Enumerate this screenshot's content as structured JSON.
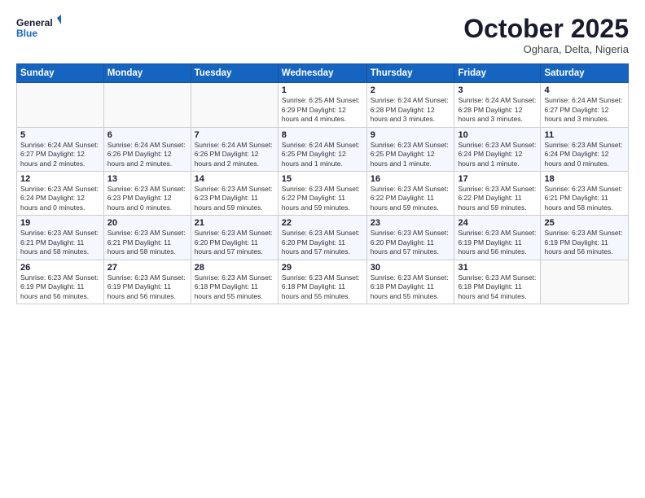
{
  "header": {
    "logo_line1": "General",
    "logo_line2": "Blue",
    "month": "October 2025",
    "location": "Oghara, Delta, Nigeria"
  },
  "days_of_week": [
    "Sunday",
    "Monday",
    "Tuesday",
    "Wednesday",
    "Thursday",
    "Friday",
    "Saturday"
  ],
  "weeks": [
    [
      {
        "day": "",
        "info": ""
      },
      {
        "day": "",
        "info": ""
      },
      {
        "day": "",
        "info": ""
      },
      {
        "day": "1",
        "info": "Sunrise: 6:25 AM\nSunset: 6:29 PM\nDaylight: 12 hours\nand 4 minutes."
      },
      {
        "day": "2",
        "info": "Sunrise: 6:24 AM\nSunset: 6:28 PM\nDaylight: 12 hours\nand 3 minutes."
      },
      {
        "day": "3",
        "info": "Sunrise: 6:24 AM\nSunset: 6:28 PM\nDaylight: 12 hours\nand 3 minutes."
      },
      {
        "day": "4",
        "info": "Sunrise: 6:24 AM\nSunset: 6:27 PM\nDaylight: 12 hours\nand 3 minutes."
      }
    ],
    [
      {
        "day": "5",
        "info": "Sunrise: 6:24 AM\nSunset: 6:27 PM\nDaylight: 12 hours\nand 2 minutes."
      },
      {
        "day": "6",
        "info": "Sunrise: 6:24 AM\nSunset: 6:26 PM\nDaylight: 12 hours\nand 2 minutes."
      },
      {
        "day": "7",
        "info": "Sunrise: 6:24 AM\nSunset: 6:26 PM\nDaylight: 12 hours\nand 2 minutes."
      },
      {
        "day": "8",
        "info": "Sunrise: 6:24 AM\nSunset: 6:25 PM\nDaylight: 12 hours\nand 1 minute."
      },
      {
        "day": "9",
        "info": "Sunrise: 6:23 AM\nSunset: 6:25 PM\nDaylight: 12 hours\nand 1 minute."
      },
      {
        "day": "10",
        "info": "Sunrise: 6:23 AM\nSunset: 6:24 PM\nDaylight: 12 hours\nand 1 minute."
      },
      {
        "day": "11",
        "info": "Sunrise: 6:23 AM\nSunset: 6:24 PM\nDaylight: 12 hours\nand 0 minutes."
      }
    ],
    [
      {
        "day": "12",
        "info": "Sunrise: 6:23 AM\nSunset: 6:24 PM\nDaylight: 12 hours\nand 0 minutes."
      },
      {
        "day": "13",
        "info": "Sunrise: 6:23 AM\nSunset: 6:23 PM\nDaylight: 12 hours\nand 0 minutes."
      },
      {
        "day": "14",
        "info": "Sunrise: 6:23 AM\nSunset: 6:23 PM\nDaylight: 11 hours\nand 59 minutes."
      },
      {
        "day": "15",
        "info": "Sunrise: 6:23 AM\nSunset: 6:22 PM\nDaylight: 11 hours\nand 59 minutes."
      },
      {
        "day": "16",
        "info": "Sunrise: 6:23 AM\nSunset: 6:22 PM\nDaylight: 11 hours\nand 59 minutes."
      },
      {
        "day": "17",
        "info": "Sunrise: 6:23 AM\nSunset: 6:22 PM\nDaylight: 11 hours\nand 59 minutes."
      },
      {
        "day": "18",
        "info": "Sunrise: 6:23 AM\nSunset: 6:21 PM\nDaylight: 11 hours\nand 58 minutes."
      }
    ],
    [
      {
        "day": "19",
        "info": "Sunrise: 6:23 AM\nSunset: 6:21 PM\nDaylight: 11 hours\nand 58 minutes."
      },
      {
        "day": "20",
        "info": "Sunrise: 6:23 AM\nSunset: 6:21 PM\nDaylight: 11 hours\nand 58 minutes."
      },
      {
        "day": "21",
        "info": "Sunrise: 6:23 AM\nSunset: 6:20 PM\nDaylight: 11 hours\nand 57 minutes."
      },
      {
        "day": "22",
        "info": "Sunrise: 6:23 AM\nSunset: 6:20 PM\nDaylight: 11 hours\nand 57 minutes."
      },
      {
        "day": "23",
        "info": "Sunrise: 6:23 AM\nSunset: 6:20 PM\nDaylight: 11 hours\nand 57 minutes."
      },
      {
        "day": "24",
        "info": "Sunrise: 6:23 AM\nSunset: 6:19 PM\nDaylight: 11 hours\nand 56 minutes."
      },
      {
        "day": "25",
        "info": "Sunrise: 6:23 AM\nSunset: 6:19 PM\nDaylight: 11 hours\nand 56 minutes."
      }
    ],
    [
      {
        "day": "26",
        "info": "Sunrise: 6:23 AM\nSunset: 6:19 PM\nDaylight: 11 hours\nand 56 minutes."
      },
      {
        "day": "27",
        "info": "Sunrise: 6:23 AM\nSunset: 6:19 PM\nDaylight: 11 hours\nand 56 minutes."
      },
      {
        "day": "28",
        "info": "Sunrise: 6:23 AM\nSunset: 6:18 PM\nDaylight: 11 hours\nand 55 minutes."
      },
      {
        "day": "29",
        "info": "Sunrise: 6:23 AM\nSunset: 6:18 PM\nDaylight: 11 hours\nand 55 minutes."
      },
      {
        "day": "30",
        "info": "Sunrise: 6:23 AM\nSunset: 6:18 PM\nDaylight: 11 hours\nand 55 minutes."
      },
      {
        "day": "31",
        "info": "Sunrise: 6:23 AM\nSunset: 6:18 PM\nDaylight: 11 hours\nand 54 minutes."
      },
      {
        "day": "",
        "info": ""
      }
    ]
  ]
}
